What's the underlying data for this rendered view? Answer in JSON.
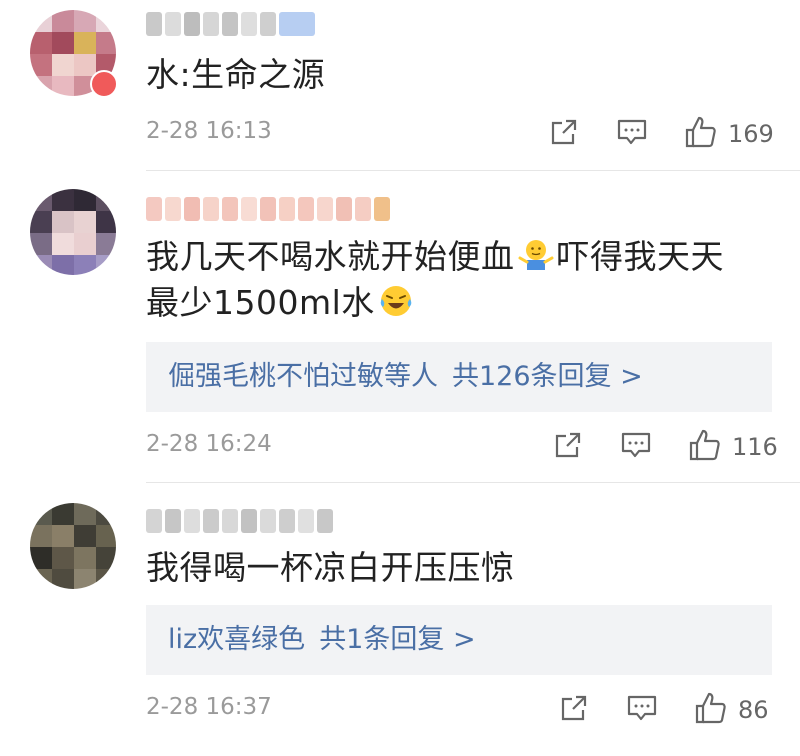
{
  "comments": [
    {
      "text": "水:生命之源",
      "time": "2-28 16:13",
      "likes": "169",
      "has_vip_tag": true
    },
    {
      "text_part1": "我几天不喝水就开始便血",
      "text_part2": "吓得我天天",
      "text_part3": "最少1500ml水",
      "reply": {
        "names": "倔强毛桃不怕过敏等人",
        "count": "共126条回复 >"
      },
      "time": "2-28 16:24",
      "likes": "116",
      "emojis": [
        "shrug-emoji-icon",
        "laugh-cry-emoji-icon"
      ]
    },
    {
      "text": "我得喝一杯凉白开压压惊",
      "reply": {
        "names": "liz欢喜绿色",
        "count": "共1条回复 >"
      },
      "time": "2-28 16:37",
      "likes": "86"
    }
  ],
  "colors": {
    "text": "#222222",
    "meta": "#9a9a9a",
    "link": "#4a6fa5",
    "reply_bg": "#f2f3f5"
  },
  "icons": [
    "share-icon",
    "comment-icon",
    "like-icon"
  ]
}
